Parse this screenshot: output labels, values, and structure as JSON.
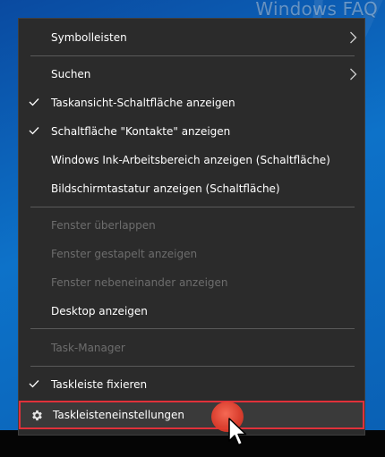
{
  "desktop": {
    "watermark": "Windows FAQ"
  },
  "menu": {
    "items": [
      {
        "label": "Symbolleisten",
        "enabled": true,
        "checked": false,
        "submenu": true
      },
      {
        "label": "Suchen",
        "enabled": true,
        "checked": false,
        "submenu": true
      },
      {
        "label": "Taskansicht-Schaltfläche anzeigen",
        "enabled": true,
        "checked": true
      },
      {
        "label": "Schaltfläche \"Kontakte\" anzeigen",
        "enabled": true,
        "checked": true
      },
      {
        "label": "Windows Ink-Arbeitsbereich anzeigen (Schaltfläche)",
        "enabled": true,
        "checked": false
      },
      {
        "label": "Bildschirmtastatur anzeigen (Schaltfläche)",
        "enabled": true,
        "checked": false
      },
      {
        "label": "Fenster überlappen",
        "enabled": false,
        "checked": false
      },
      {
        "label": "Fenster gestapelt anzeigen",
        "enabled": false,
        "checked": false
      },
      {
        "label": "Fenster nebeneinander anzeigen",
        "enabled": false,
        "checked": false
      },
      {
        "label": "Desktop anzeigen",
        "enabled": true,
        "checked": false
      },
      {
        "label": "Task-Manager",
        "enabled": false,
        "checked": false
      },
      {
        "label": "Taskleiste fixieren",
        "enabled": true,
        "checked": true
      },
      {
        "label": "Taskleisteneinstellungen",
        "enabled": true,
        "checked": false,
        "icon": "gear-icon",
        "highlighted": true
      }
    ]
  },
  "colors": {
    "menu_bg": "#2b2b2b",
    "text": "#ffffff",
    "disabled_text": "#6d6d6d",
    "separator": "#5a5a5a",
    "highlight_border": "#e0313a",
    "click_marker": "#e2402f"
  }
}
